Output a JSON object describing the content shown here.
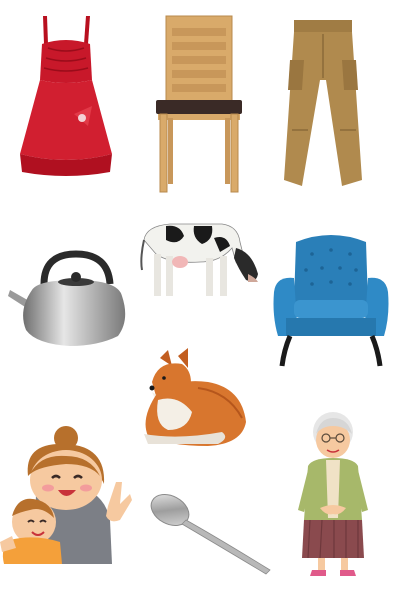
{
  "items": [
    {
      "icon": "red-dress-icon"
    },
    {
      "icon": "wooden-chair-icon"
    },
    {
      "icon": "khaki-pants-icon"
    },
    {
      "icon": "tea-kettle-icon"
    },
    {
      "icon": "cow-icon"
    },
    {
      "icon": "blue-armchair-icon"
    },
    {
      "icon": "fox-icon"
    },
    {
      "icon": "mother-and-baby-icon"
    },
    {
      "icon": "spoon-icon"
    },
    {
      "icon": "grandmother-icon"
    }
  ],
  "colors": {
    "background": "#ffffff",
    "dress": "#c8182a",
    "chair_wood": "#d9aa6a",
    "pants": "#b08a4e",
    "kettle": "#a8a8a8",
    "armchair": "#2a7fb8",
    "fox": "#d8762e",
    "skin": "#f6c9a0"
  }
}
